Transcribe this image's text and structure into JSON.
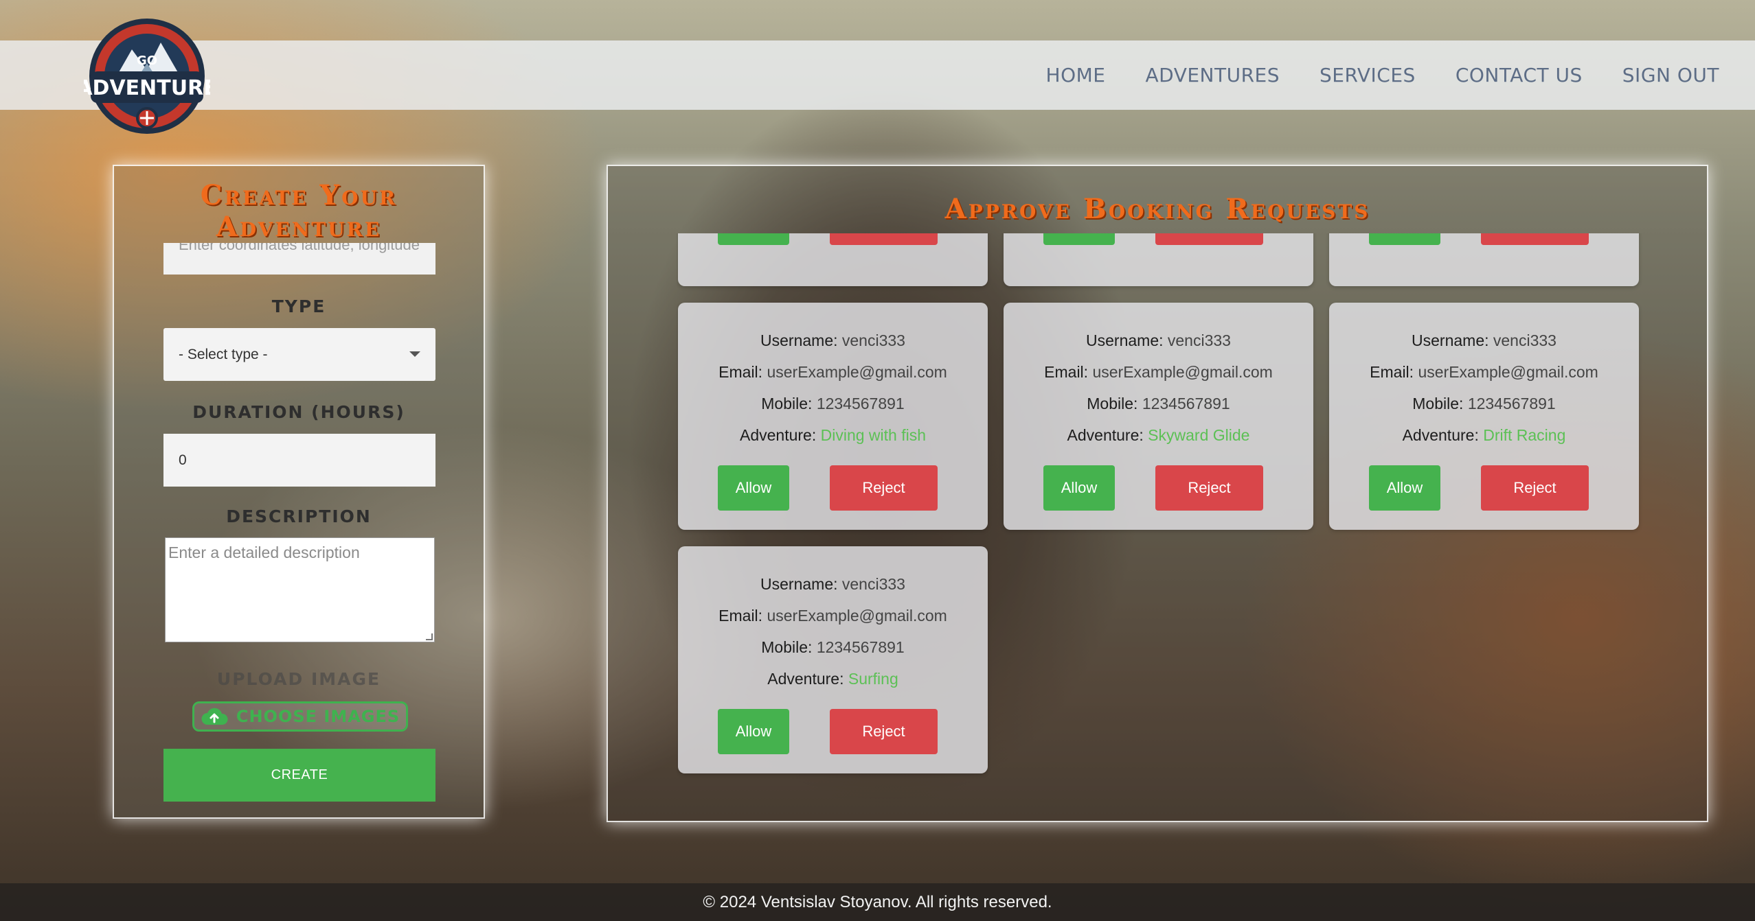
{
  "header": {
    "logo_top": "GO",
    "logo_main": "ADVENTURE",
    "nav": [
      "HOME",
      "ADVENTURES",
      "SERVICES",
      "CONTACT US",
      "SIGN OUT"
    ]
  },
  "create_form": {
    "title_line1": "Create Your",
    "title_line2": "Adventure",
    "coordinates_placeholder": "Enter coordinates latitude, longitude",
    "type_label": "TYPE",
    "type_value": "- Select type -",
    "duration_label": "DURATION (HOURS)",
    "duration_value": "0",
    "description_label": "DESCRIPTION",
    "description_placeholder": "Enter a detailed description",
    "upload_label": "UPLOAD IMAGE",
    "choose_label": "CHOOSE IMAGES",
    "create_label": "CREATE"
  },
  "bookings": {
    "title": "Approve Booking Requests",
    "labels": {
      "username": "Username:",
      "email": "Email:",
      "mobile": "Mobile:",
      "adventure": "Adventure:",
      "allow": "Allow",
      "reject": "Reject"
    },
    "requests": [
      {
        "username": "venci333",
        "email": "userExample@gmail.com",
        "mobile": "1234567891",
        "adventure": "Diving with fish"
      },
      {
        "username": "venci333",
        "email": "userExample@gmail.com",
        "mobile": "1234567891",
        "adventure": "Skyward Glide"
      },
      {
        "username": "venci333",
        "email": "userExample@gmail.com",
        "mobile": "1234567891",
        "adventure": "Drift Racing"
      },
      {
        "username": "venci333",
        "email": "userExample@gmail.com",
        "mobile": "1234567891",
        "adventure": "Surfing"
      }
    ]
  },
  "footer": {
    "text": "© 2024 Ventsislav Stoyanov. All rights reserved."
  },
  "colors": {
    "accent_orange": "#f06b1c",
    "allow_green": "#45b24e",
    "reject_red": "#d9464a",
    "adventure_green": "#5cc055",
    "nav_text": "#5d6d86"
  }
}
